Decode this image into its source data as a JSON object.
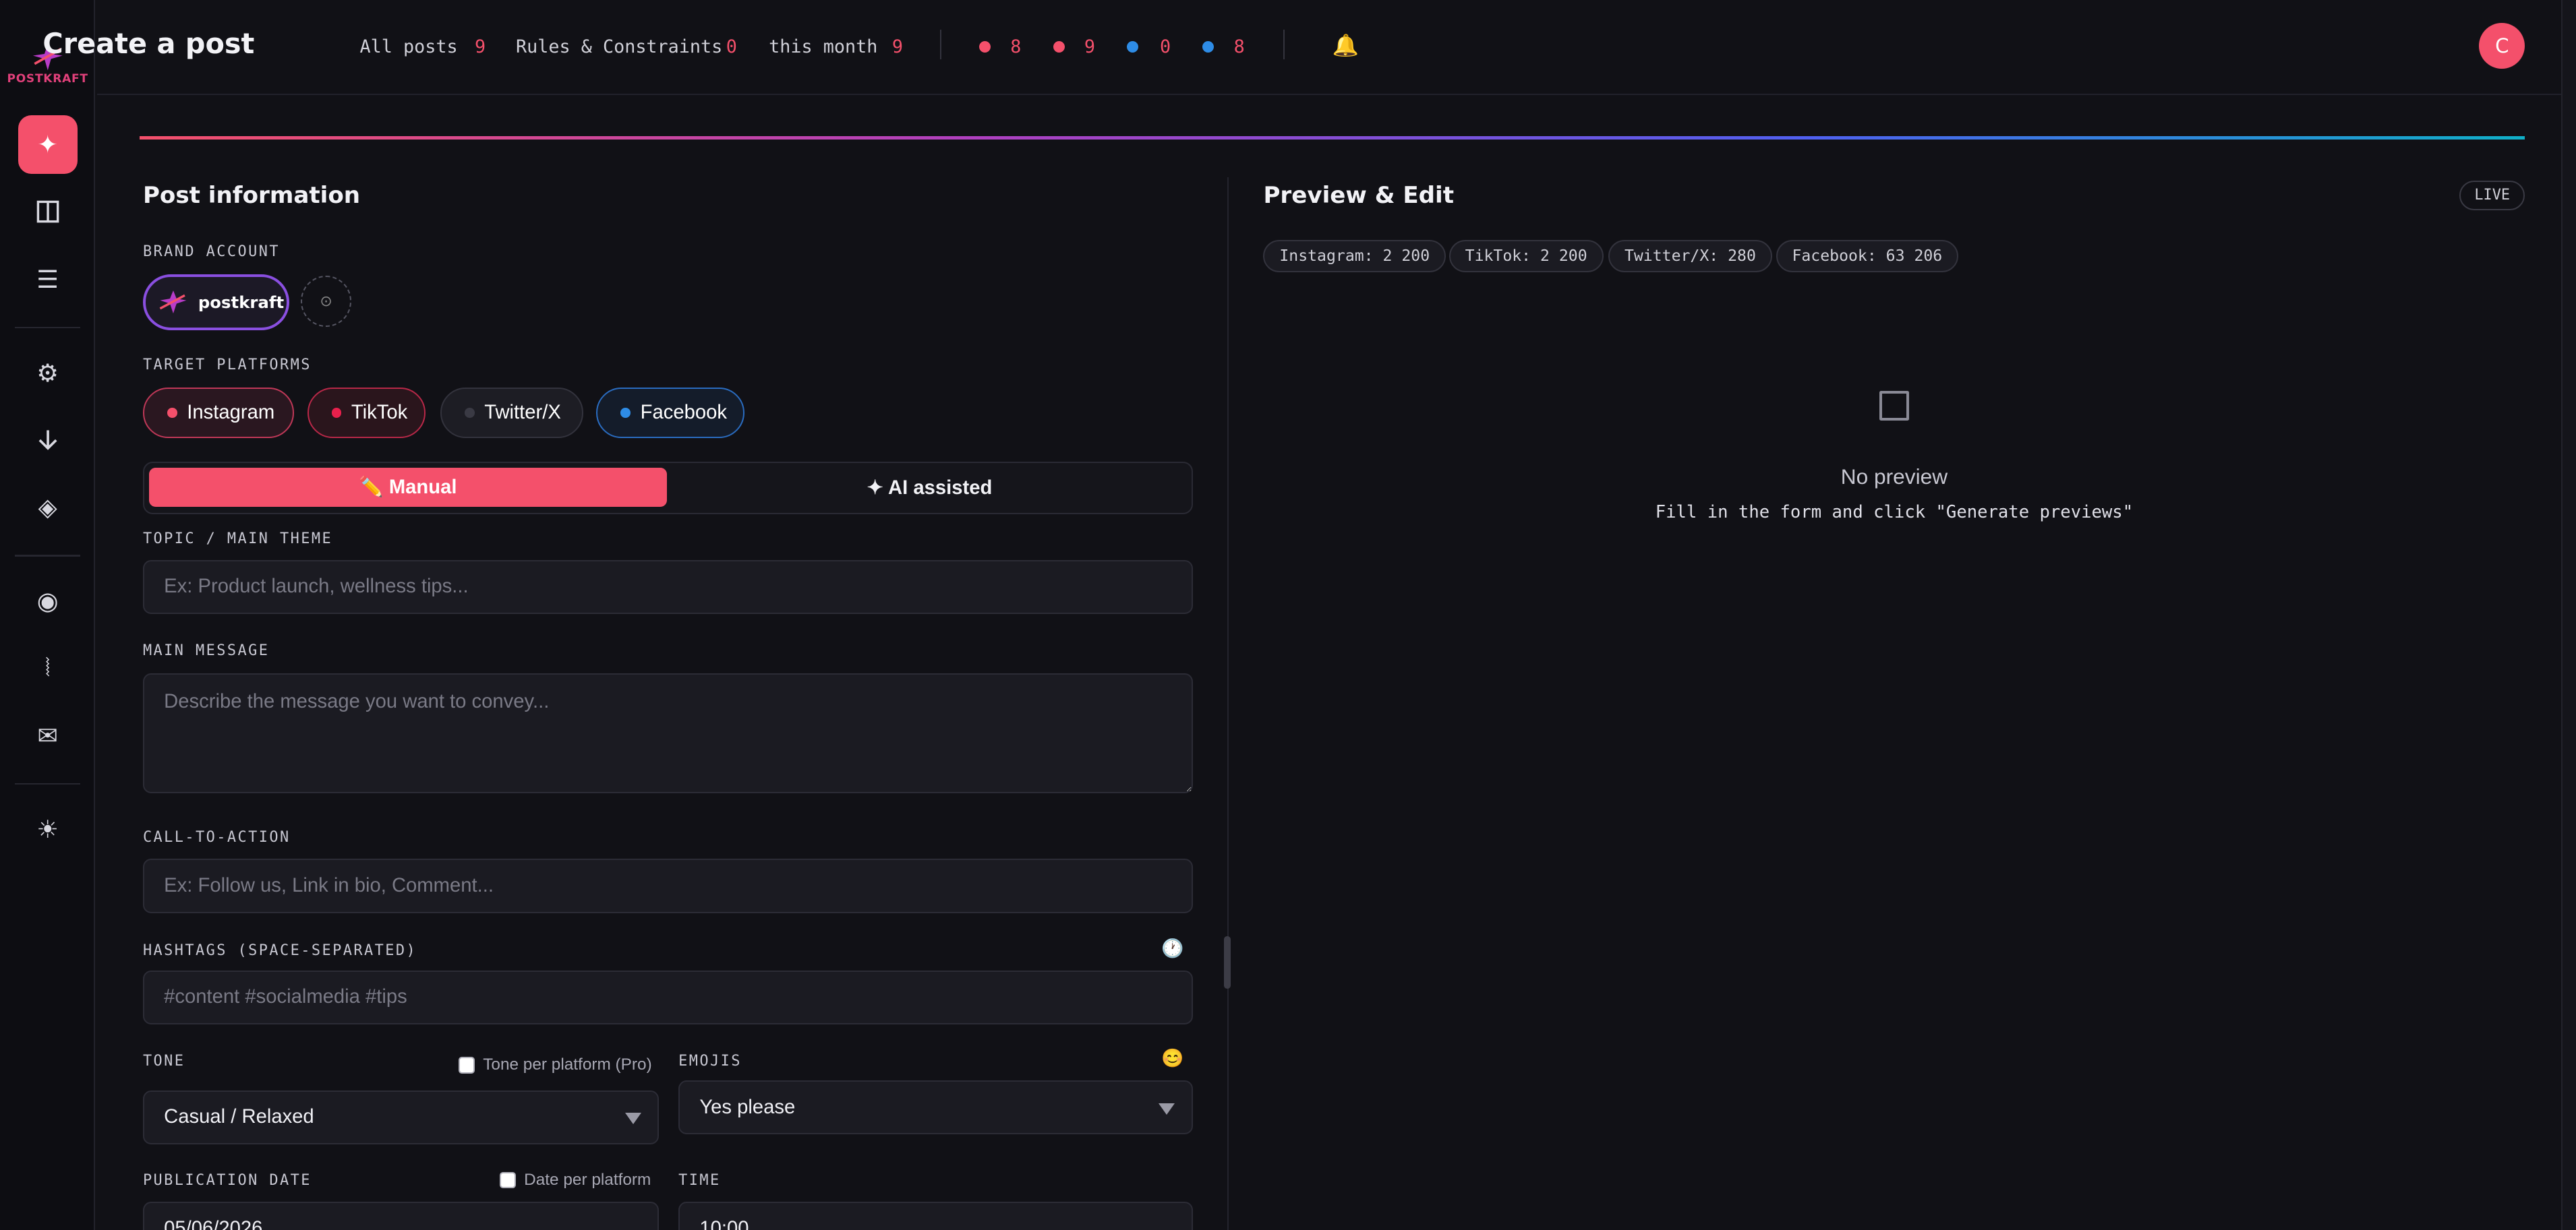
{
  "app": {
    "logo_text": "POSTKRAFT",
    "avatar_initial": "C"
  },
  "header": {
    "title": "Create a post",
    "stats": [
      {
        "label": "All posts",
        "value": "9"
      },
      {
        "label": "Rules & Constraints",
        "value": "0"
      },
      {
        "label": "this month",
        "value": "9"
      }
    ],
    "platform_counts": [
      {
        "color": "#f4506b",
        "value": "8"
      },
      {
        "color": "#f4506b",
        "value": "9"
      },
      {
        "color": "#2e8ce6",
        "value": "0"
      },
      {
        "color": "#2e8ce6",
        "value": "8"
      }
    ]
  },
  "sidebar": {
    "items": [
      "sparkle-icon",
      "columns-icon",
      "list-icon",
      "gear-icon",
      "arrow-down-icon",
      "diamond-icon",
      "record-icon",
      "squiggle-icon",
      "mail-icon",
      "sun-icon"
    ]
  },
  "form": {
    "section_title": "Post information",
    "brand_label": "BRAND ACCOUNT",
    "brand_name": "postkraft",
    "platforms_label": "TARGET PLATFORMS",
    "platforms": [
      {
        "name": "Instagram",
        "color": "#f4506b"
      },
      {
        "name": "TikTok",
        "color": "#e8204c"
      },
      {
        "name": "Twitter/X",
        "color": "#3a3a44"
      },
      {
        "name": "Facebook",
        "color": "#2e8ce6"
      }
    ],
    "mode_manual": "✏️ Manual",
    "mode_ai": "✦ AI assisted",
    "topic_label": "TOPIC / MAIN THEME",
    "topic_placeholder": "Ex: Product launch, wellness tips...",
    "message_label": "MAIN MESSAGE",
    "message_placeholder": "Describe the message you want to convey...",
    "cta_label": "CALL-TO-ACTION",
    "cta_placeholder": "Ex: Follow us, Link in bio, Comment...",
    "hashtags_label": "HASHTAGS (SPACE-SEPARATED)",
    "hashtags_placeholder": "#content #socialmedia #tips",
    "tone_label": "TONE",
    "tone_per_platform": "Tone per platform (Pro)",
    "tone_value": "Casual / Relaxed",
    "emojis_label": "EMOJIS",
    "emojis_value": "Yes please",
    "pubdate_label": "PUBLICATION DATE",
    "date_per_platform": "Date per platform",
    "time_label": "TIME",
    "date_value": "05/06/2026",
    "time_value": "10:00"
  },
  "preview": {
    "title": "Preview & Edit",
    "badge": "LIVE",
    "limits": [
      "Instagram: 2 200",
      "TikTok: 2 200",
      "Twitter/X: 280",
      "Facebook: 63 206"
    ],
    "empty_title": "No preview",
    "empty_hint": "Fill in the form and click \"Generate previews\""
  }
}
